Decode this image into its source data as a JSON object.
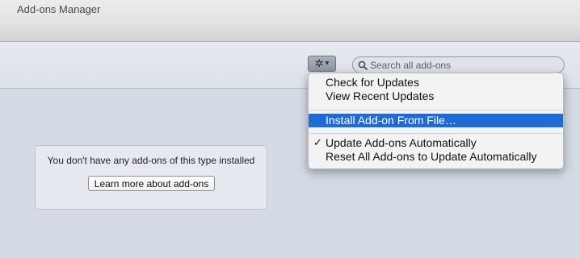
{
  "window": {
    "title": "Add-ons Manager"
  },
  "toolbar": {
    "gear_icon": "gear-icon",
    "search": {
      "placeholder": "Search all add-ons",
      "value": ""
    }
  },
  "main": {
    "empty_message": "You don't have any add-ons of this type installed",
    "learn_more_label": "Learn more about add-ons"
  },
  "menu": {
    "items": [
      {
        "label": "Check for Updates"
      },
      {
        "label": "View Recent Updates"
      },
      {
        "label": "Install Add-on From File…",
        "highlighted": true
      },
      {
        "label": "Update Add-ons Automatically",
        "checked": true,
        "check_glyph": "✓"
      },
      {
        "label": "Reset All Add-ons to Update Automatically"
      }
    ]
  },
  "colors": {
    "highlight": "#1c6bd6",
    "background": "#d5dbe4"
  }
}
